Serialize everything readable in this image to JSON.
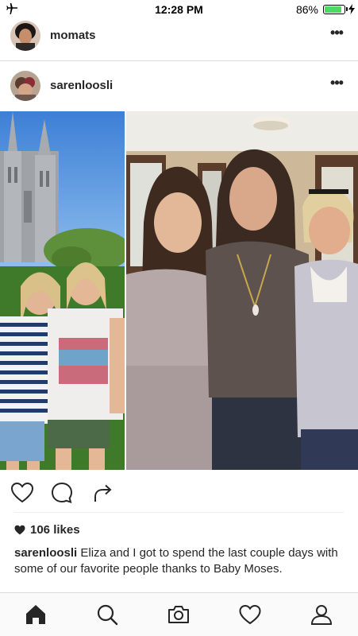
{
  "status_bar": {
    "time": "12:28 PM",
    "battery_percent": "86%",
    "battery_level": 0.86
  },
  "posts": [
    {
      "username": "momats",
      "more_label": "•••"
    },
    {
      "username": "sarenloosli",
      "more_label": "•••"
    }
  ],
  "post": {
    "likes": "106 likes",
    "caption_user": "sarenloosli",
    "caption_text": " Eliza and I got to spend the last couple days with some of our favorite people thanks to Baby Moses."
  },
  "actions": [
    "heart-icon",
    "comment-icon",
    "share-icon"
  ],
  "nav": [
    "home-icon",
    "search-icon",
    "camera-icon",
    "activity-heart-icon",
    "profile-icon"
  ],
  "colors": {
    "text": "#262626",
    "divider": "#dbdbdb",
    "battery": "#4cd964"
  }
}
